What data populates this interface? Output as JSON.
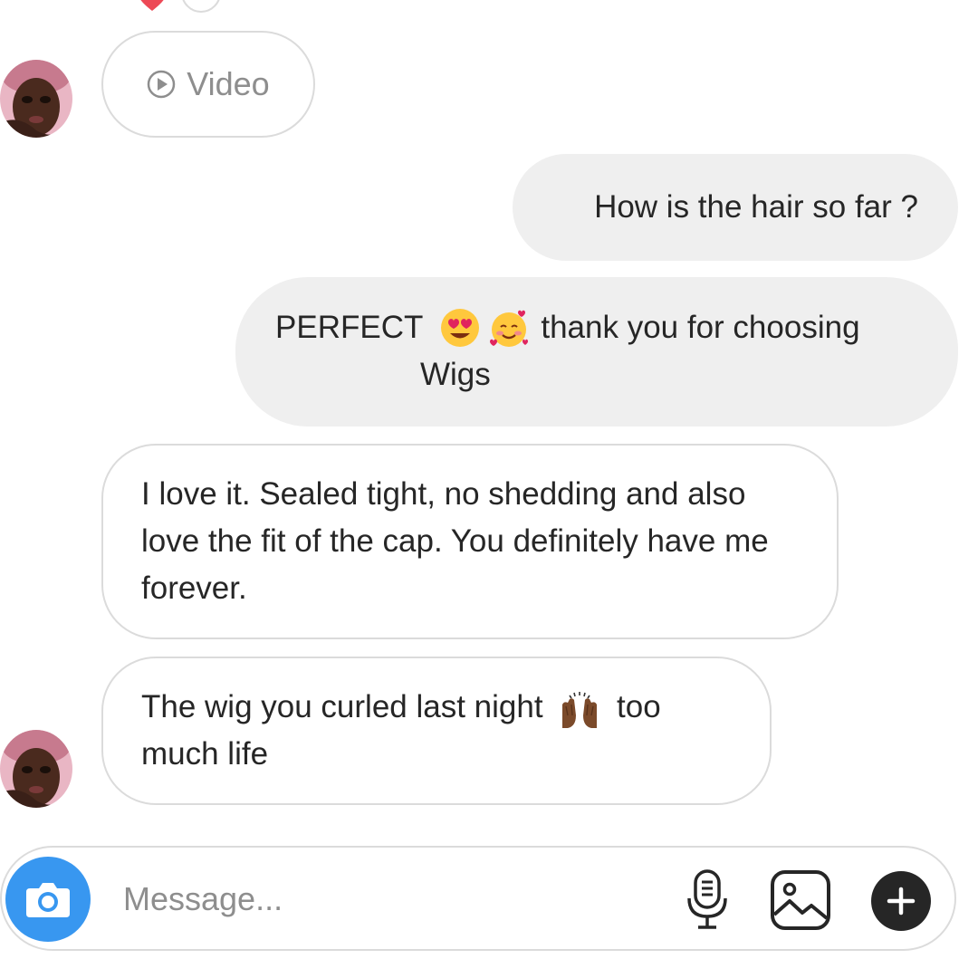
{
  "colors": {
    "accent_blue": "#3897f0",
    "bubble_gray": "#efefef",
    "outline_gray": "#dbdbdb",
    "text": "#262626",
    "placeholder": "#8e8e8e",
    "heart_red": "#ed4956"
  },
  "reactions": {
    "icons": [
      "heart-icon",
      "reaction-circle"
    ]
  },
  "video_message": {
    "icon": "play-circle-icon",
    "label": "Video"
  },
  "messages": [
    {
      "sender": "me",
      "text": "How is the hair so far ?"
    },
    {
      "sender": "me",
      "line1_a": "PERFECT",
      "emoji": [
        "heart-eyes-emoji",
        "smiling-face-with-hearts-emoji"
      ],
      "line1_b": "thank you for choosing",
      "line2": "Wigs"
    },
    {
      "sender": "them",
      "text": "I love it. Sealed tight, no shedding and also love the fit of the cap. You definitely have me forever."
    },
    {
      "sender": "them",
      "text_a": "The wig you curled last night",
      "emoji": "raising-hands-emoji",
      "text_b": "too much life"
    }
  ],
  "composer": {
    "placeholder": "Message...",
    "icons": [
      "camera-icon",
      "microphone-icon",
      "gallery-icon",
      "plus-icon"
    ]
  }
}
